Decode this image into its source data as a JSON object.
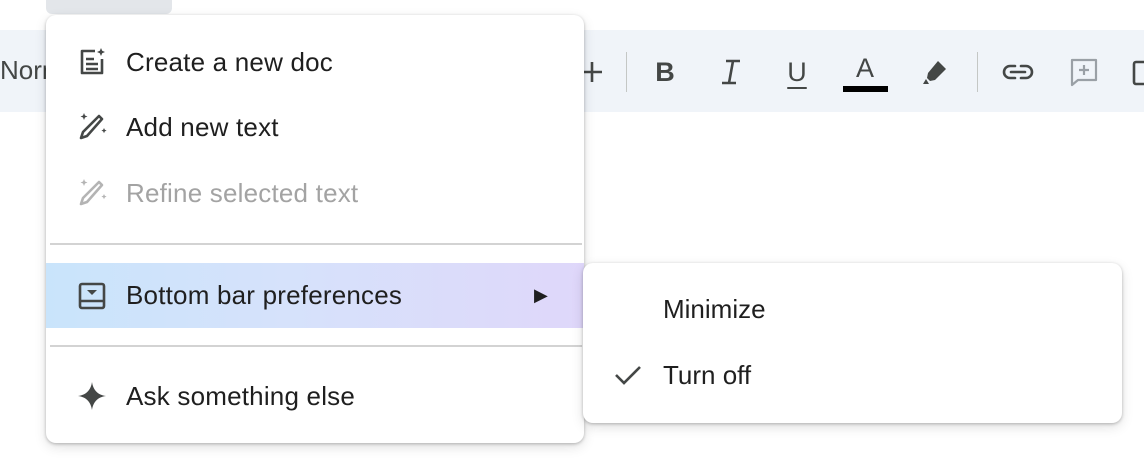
{
  "toolbar": {
    "style_fragment": "Norm",
    "bold_label": "B",
    "italic_label": "I",
    "underline_label": "U",
    "text_color_label": "A",
    "text_color_swatch": "#000000"
  },
  "menu": {
    "items": [
      {
        "label": "Create a new doc",
        "icon": "doc-sparkle-icon",
        "enabled": true
      },
      {
        "label": "Add new text",
        "icon": "magic-pen-icon",
        "enabled": true
      },
      {
        "label": "Refine selected text",
        "icon": "magic-pen-icon",
        "enabled": false
      },
      {
        "label": "Bottom bar preferences",
        "icon": "bottom-bar-icon",
        "enabled": true,
        "has_submenu": true,
        "highlighted": true
      },
      {
        "label": "Ask something else",
        "icon": "sparkle-icon",
        "enabled": true
      }
    ],
    "submenu_arrow": "▶"
  },
  "submenu": {
    "items": [
      {
        "label": "Minimize",
        "checked": false
      },
      {
        "label": "Turn off",
        "checked": true
      }
    ]
  }
}
